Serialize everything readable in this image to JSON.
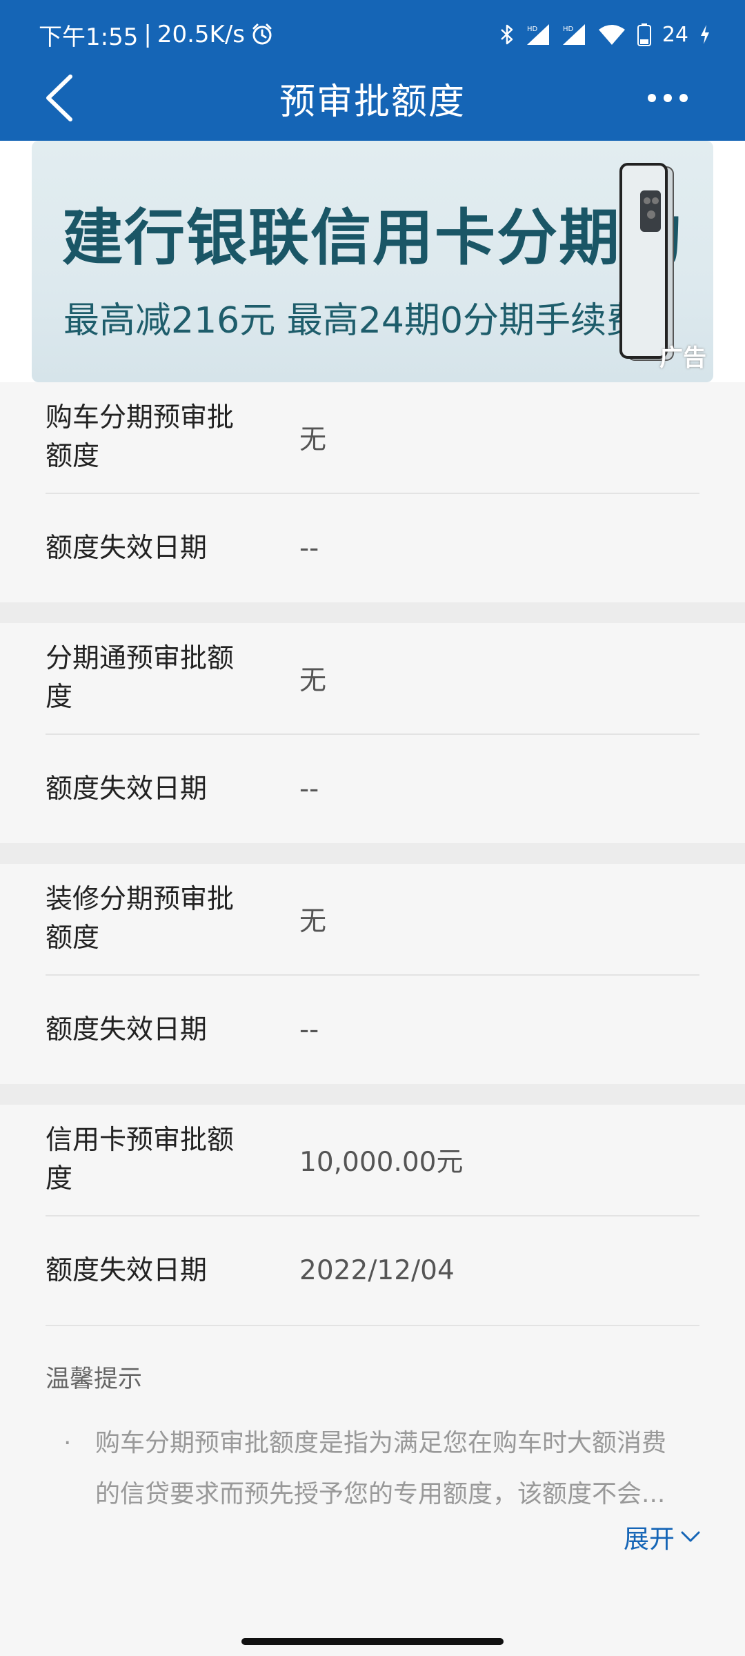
{
  "status_bar": {
    "time": "下午1:55",
    "speed": "20.5K/s",
    "battery": "24"
  },
  "header": {
    "title": "预审批额度"
  },
  "banner": {
    "title": "建行银联信用卡分期购",
    "subtitle": "最高减216元 最高24期0分期手续费",
    "ad_tag": "广告"
  },
  "sections": [
    {
      "label": "购车分期预审批额度",
      "value": "无",
      "expiry_label": "额度失效日期",
      "expiry": "--"
    },
    {
      "label": "分期通预审批额度",
      "value": "无",
      "expiry_label": "额度失效日期",
      "expiry": "--"
    },
    {
      "label": "装修分期预审批额度",
      "value": "无",
      "expiry_label": "额度失效日期",
      "expiry": "--"
    },
    {
      "label": "信用卡预审批额度",
      "value": "10,000.00元",
      "expiry_label": "额度失效日期",
      "expiry": "2022/12/04"
    }
  ],
  "tips": {
    "title": "温馨提示",
    "bullet": "·",
    "line1": "购车分期预审批额度是指为满足您在购车时大额消费",
    "line2": "的信贷要求而预先授予您的专用额度，该额度不会...",
    "expand": "展开"
  },
  "colors": {
    "primary": "#1565b6",
    "background": "#f6f6f6",
    "divider": "#e3e3e3"
  }
}
